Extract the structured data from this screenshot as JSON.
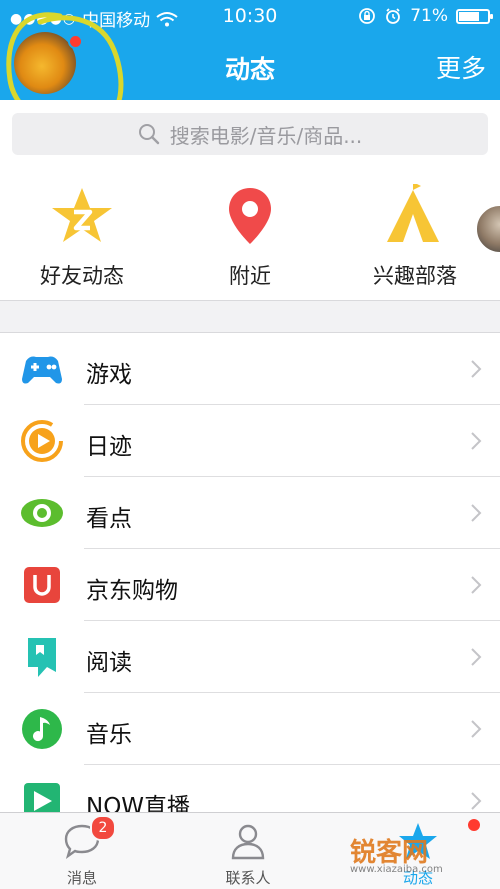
{
  "status_bar": {
    "dots": "●●●●○",
    "carrier": "中国移动",
    "time": "10:30",
    "battery_pct": "71%",
    "battery_fraction": 0.71
  },
  "nav": {
    "title": "动态",
    "more": "更多"
  },
  "search": {
    "placeholder": "搜索电影/音乐/商品..."
  },
  "quick": [
    {
      "label": "好友动态",
      "icon": "friends-star-icon"
    },
    {
      "label": "附近",
      "icon": "location-pin-icon"
    },
    {
      "label": "兴趣部落",
      "icon": "tribe-tent-icon"
    }
  ],
  "list": [
    {
      "label": "游戏",
      "icon": "gamepad-icon",
      "color": "#2196e8"
    },
    {
      "label": "日迹",
      "icon": "play-circle-icon",
      "color": "#f7a21b"
    },
    {
      "label": "看点",
      "icon": "eye-icon",
      "color": "#5cbd2e"
    },
    {
      "label": "京东购物",
      "icon": "jd-bag-icon",
      "color": "#e8453c"
    },
    {
      "label": "阅读",
      "icon": "book-icon",
      "color": "#25c2b3"
    },
    {
      "label": "音乐",
      "icon": "music-note-icon",
      "color": "#2eb84a"
    },
    {
      "label": "NOW直播",
      "icon": "now-live-icon",
      "color": "#22b573"
    }
  ],
  "tabbar": [
    {
      "label": "消息",
      "badge": "2"
    },
    {
      "label": "联系人"
    },
    {
      "label": "动态"
    }
  ],
  "watermark": {
    "text": "锐客网",
    "sub": "www.xiazaiba.com"
  },
  "colors": {
    "accent": "#1aa7ec",
    "badge": "#f2493f",
    "dot": "#ff3b30"
  }
}
